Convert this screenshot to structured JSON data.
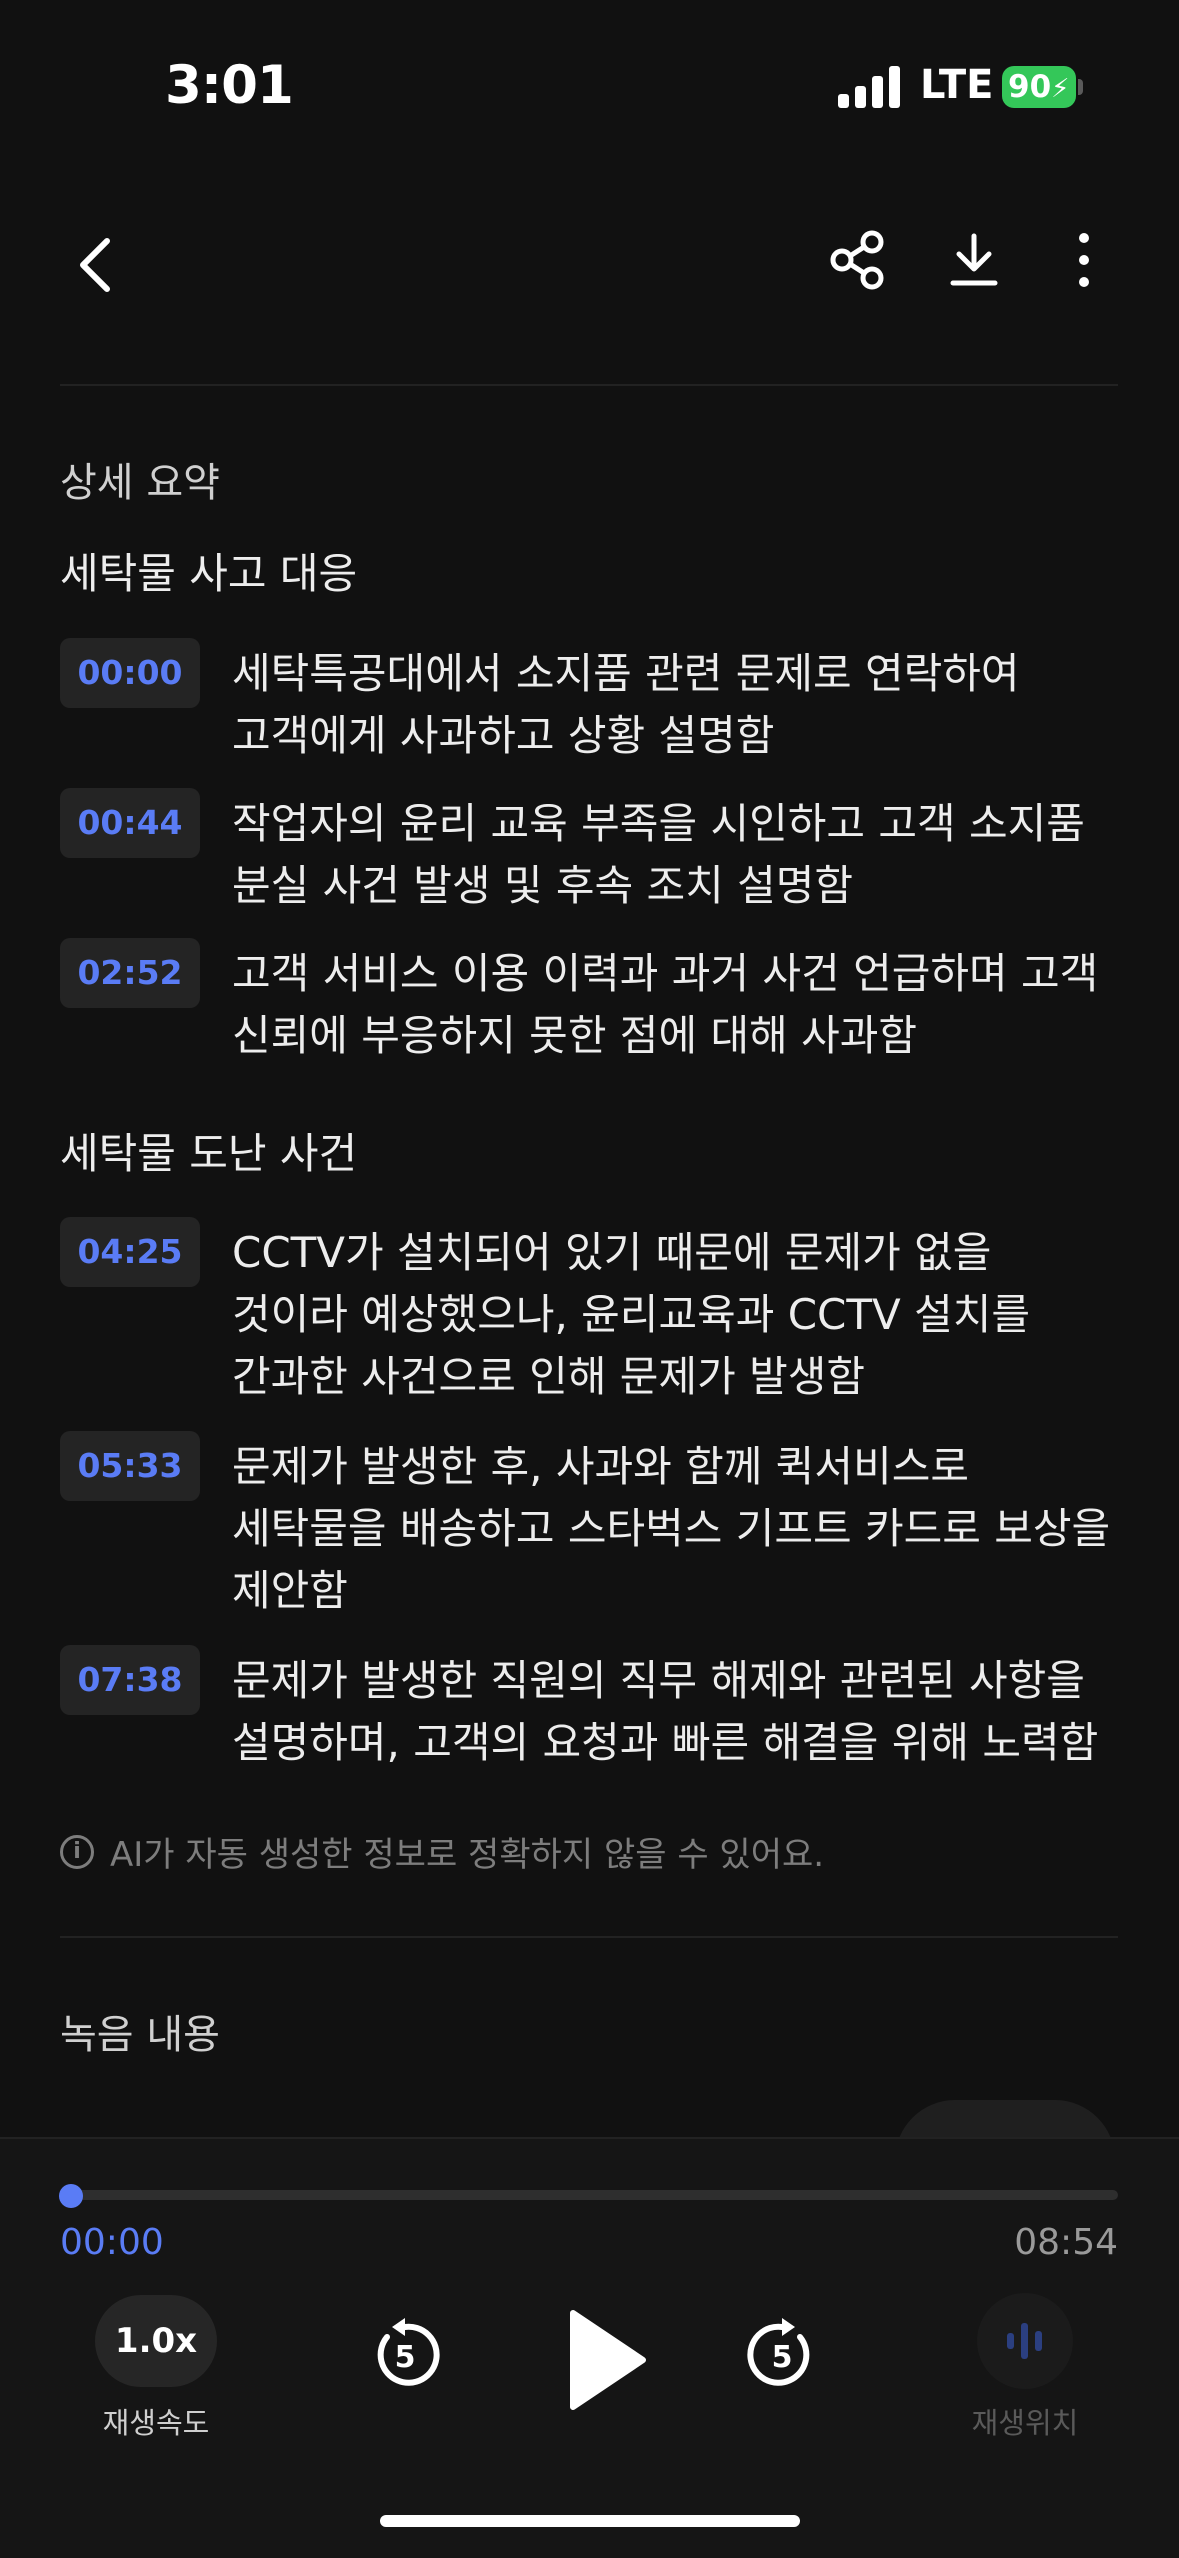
{
  "status_bar": {
    "time": "3:01",
    "network": "LTE",
    "battery": "90"
  },
  "summary": {
    "heading": "상세 요약",
    "groups": [
      {
        "title": "세탁물 사고 대응",
        "items": [
          {
            "time": "00:00",
            "line1": "세탁특공대에서 소지품 관련 문제로 연락하여",
            "line2": "고객에게 사과하고 상황 설명함"
          },
          {
            "time": "00:44",
            "line1": "작업자의 윤리 교육 부족을 시인하고 고객 소지품",
            "line2": "분실 사건 발생 및 후속 조치 설명함"
          },
          {
            "time": "02:52",
            "line1": "고객 서비스 이용 이력과 과거 사건 언급하며 고객",
            "line2": "신뢰에 부응하지 못한 점에 대해 사과함"
          }
        ]
      },
      {
        "title": "세탁물 도난 사건",
        "items": [
          {
            "time": "04:25",
            "line1": "CCTV가 설치되어 있기 때문에 문제가 없을",
            "line2": "것이라 예상했으나, 윤리교육과 CCTV 설치를",
            "line3": "간과한 사건으로 인해 문제가 발생함"
          },
          {
            "time": "05:33",
            "line1": "문제가 발생한 후, 사과와 함께 퀵서비스로",
            "line2": "세탁물을 배송하고 스타벅스 기프트 카드로 보상을",
            "line3": "제안함"
          },
          {
            "time": "07:38",
            "line1": "문제가 발생한 직원의 직무 해제와 관련된 사항을",
            "line2": "설명하며, 고객의 요청과 빠른 해결을 위해 노력함"
          }
        ]
      }
    ],
    "notice": "AI가 자동 생성한 정보로 정확하지 않을 수 있어요."
  },
  "recording": {
    "heading": "녹음 내용"
  },
  "player": {
    "current_time": "00:00",
    "total_time": "08:54",
    "progress": 0,
    "speed": "1.0x",
    "speed_label": "재생속도",
    "skip_seconds": "5",
    "position_label": "재생위치"
  },
  "colors": {
    "accent": "#5a7cf5",
    "background": "#111111"
  }
}
